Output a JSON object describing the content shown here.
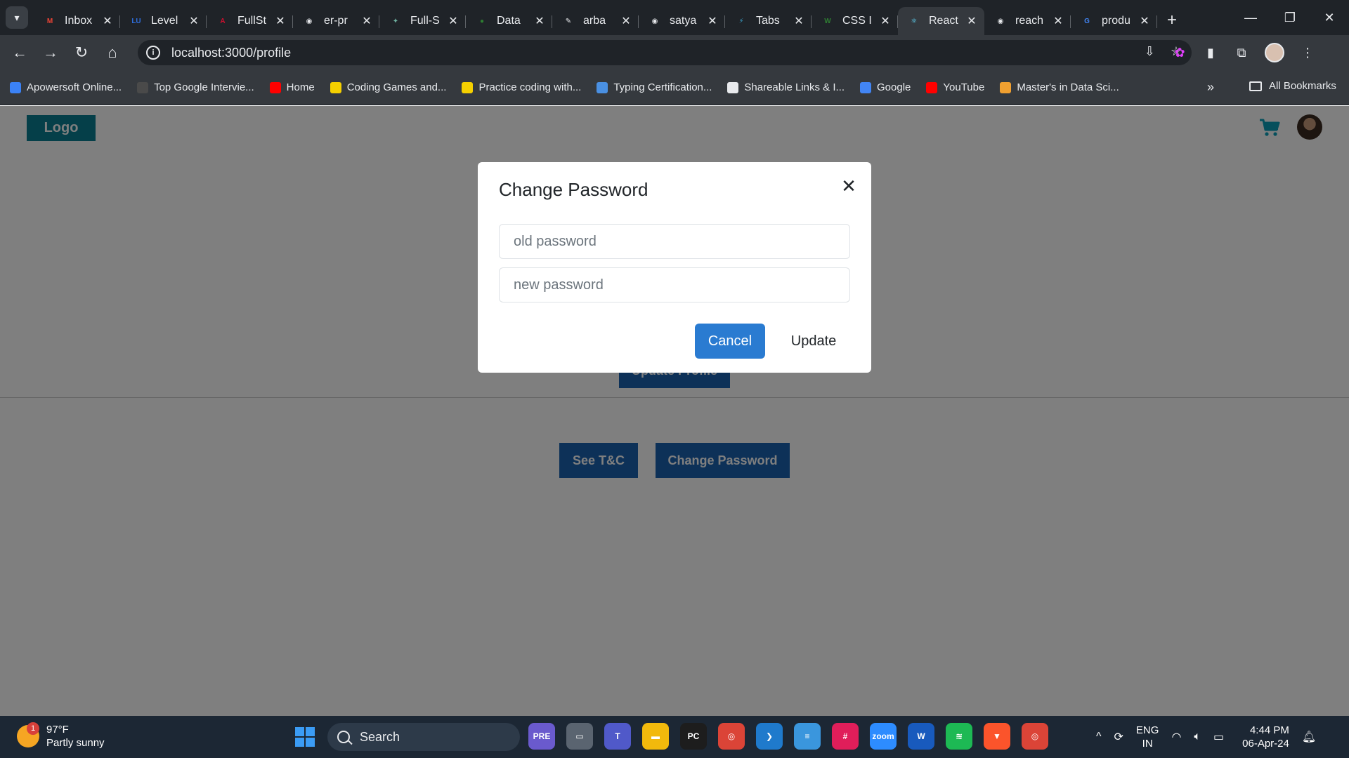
{
  "browser": {
    "tabs": [
      {
        "title": "Inbox",
        "color": "#ea4335",
        "glyph": "M"
      },
      {
        "title": "Level",
        "color": "#2f6fe0",
        "glyph": "LU"
      },
      {
        "title": "FullSt",
        "color": "#c8102e",
        "glyph": "A"
      },
      {
        "title": "er-pr",
        "color": "#e8eaed",
        "glyph": "◉"
      },
      {
        "title": "Full-S",
        "color": "#6fb1a0",
        "glyph": "✦"
      },
      {
        "title": "Data",
        "color": "#2e7d32",
        "glyph": "●"
      },
      {
        "title": "arba",
        "color": "#e8eaed",
        "glyph": "✎"
      },
      {
        "title": "satya",
        "color": "#e8eaed",
        "glyph": "◉"
      },
      {
        "title": "Tabs",
        "color": "#3aa0c8",
        "glyph": "⚡"
      },
      {
        "title": "CSS I",
        "color": "#2e7d32",
        "glyph": "W"
      },
      {
        "title": "React",
        "color": "#61dafb",
        "glyph": "⚛"
      },
      {
        "title": "reach",
        "color": "#e8eaed",
        "glyph": "◉"
      },
      {
        "title": "produ",
        "color": "#4285f4",
        "glyph": "G"
      }
    ],
    "active_tab": 10,
    "close_glyph": "✕",
    "new_tab_glyph": "+",
    "window_controls": {
      "minimize": "—",
      "restore": "❐",
      "close": "✕"
    },
    "address": "localhost:3000/profile",
    "nav": {
      "back": "←",
      "forward": "→",
      "reload": "↻",
      "home": "⌂"
    },
    "info_glyph": "i",
    "bookmarks": [
      {
        "label": "Apowersoft Online...",
        "color": "#3b82f6"
      },
      {
        "label": "Top Google Intervie...",
        "color": "#4a4a4a"
      },
      {
        "label": "Home",
        "color": "#ff0000"
      },
      {
        "label": "Coding Games and...",
        "color": "#f5d000"
      },
      {
        "label": "Practice coding with...",
        "color": "#f5d000"
      },
      {
        "label": "Typing Certification...",
        "color": "#4a90e2"
      },
      {
        "label": "Shareable Links & I...",
        "color": "#e8eaed"
      },
      {
        "label": "Google",
        "color": "#4285f4"
      },
      {
        "label": "YouTube",
        "color": "#ff0000"
      },
      {
        "label": "Master's in Data Sci...",
        "color": "#f0a030"
      }
    ],
    "bookmarks_more": "»",
    "all_bookmarks": "All Bookmarks"
  },
  "app": {
    "logo": "Logo",
    "update_profile": "Update Profile",
    "see_tc": "See T&C",
    "change_password": "Change Password"
  },
  "modal": {
    "title": "Change Password",
    "close_glyph": "✕",
    "old_password_placeholder": "old password",
    "new_password_placeholder": "new password",
    "cancel_label": "Cancel",
    "update_label": "Update"
  },
  "taskbar": {
    "weather_temp": "97°F",
    "weather_desc": "Partly sunny",
    "weather_badge": "1",
    "search_label": "Search",
    "apps": [
      {
        "name": "copilot",
        "color": "#6a5acd",
        "glyph": "PRE"
      },
      {
        "name": "taskview",
        "color": "#5a6470",
        "glyph": "▭"
      },
      {
        "name": "teams",
        "color": "#5059c9",
        "glyph": "T"
      },
      {
        "name": "explorer",
        "color": "#f2b90c",
        "glyph": "▬"
      },
      {
        "name": "pycharm",
        "color": "#1d1d1d",
        "glyph": "PC"
      },
      {
        "name": "chrome",
        "color": "#db4437",
        "glyph": "◎"
      },
      {
        "name": "vscode",
        "color": "#1f7acc",
        "glyph": "❯"
      },
      {
        "name": "notepad",
        "color": "#3a96dd",
        "glyph": "≡"
      },
      {
        "name": "slack",
        "color": "#e01e5a",
        "glyph": "#"
      },
      {
        "name": "zoom",
        "color": "#2d8cff",
        "glyph": "zoom"
      },
      {
        "name": "word",
        "color": "#185abd",
        "glyph": "W"
      },
      {
        "name": "spotify",
        "color": "#1db954",
        "glyph": "≋"
      },
      {
        "name": "brave",
        "color": "#fb542b",
        "glyph": "▼"
      },
      {
        "name": "chrome-profile",
        "color": "#db4437",
        "glyph": "◎"
      }
    ],
    "tray_chevron": "^",
    "language": "ENG",
    "region": "IN",
    "time": "4:44 PM",
    "date": "06-Apr-24"
  }
}
